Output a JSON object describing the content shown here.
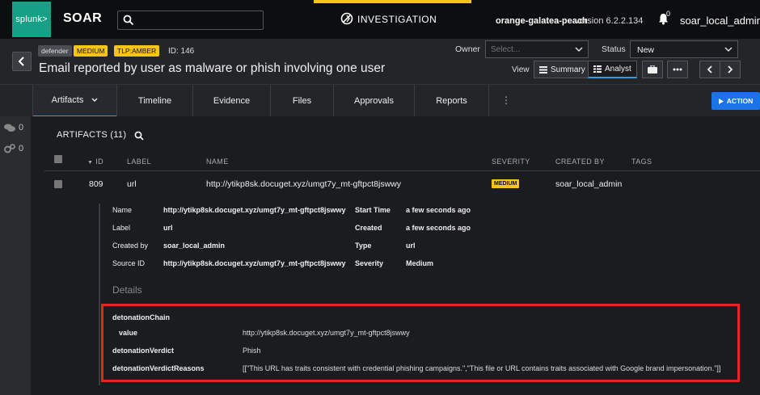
{
  "app": {
    "logo_text": "splunk>",
    "name": "SOAR"
  },
  "topbar": {
    "mode": "INVESTIGATION",
    "host": "orange-galatea-peach",
    "version": "version 6.2.2.134",
    "notification_count": "0",
    "user": "soar_local_admin"
  },
  "container": {
    "tags": [
      "defender",
      "MEDIUM",
      "TLP:AMBER"
    ],
    "id_label": "ID: 146",
    "title": "Email reported by user as malware or phish involving one user",
    "owner_label": "Owner",
    "owner_placeholder": "Select...",
    "status_label": "Status",
    "status_value": "New",
    "view_label": "View",
    "view_summary": "Summary",
    "view_analyst": "Analyst"
  },
  "tabs": [
    "Artifacts",
    "Timeline",
    "Evidence",
    "Files",
    "Approvals",
    "Reports"
  ],
  "action_label": "ACTION",
  "rail": {
    "comments": "0",
    "workflow": "0"
  },
  "artifacts": {
    "title": "ARTIFACTS (11)",
    "headers": {
      "id": "ID",
      "label": "LABEL",
      "name": "NAME",
      "severity": "SEVERITY",
      "created_by": "CREATED BY",
      "tags": "TAGS"
    },
    "row": {
      "id": "809",
      "label": "url",
      "name": "http://ytikp8sk.docuget.xyz/umgt7y_mt-gftpct8jswwy",
      "severity": "MEDIUM",
      "created_by": "soar_local_admin"
    },
    "detail": {
      "name_k": "Name",
      "name_v": "http://ytikp8sk.docuget.xyz/umgt7y_mt-gftpct8jswwy",
      "label_k": "Label",
      "label_v": "url",
      "createdby_k": "Created by",
      "createdby_v": "soar_local_admin",
      "sourceid_k": "Source ID",
      "sourceid_v": "http://ytikp8sk.docuget.xyz/umgt7y_mt-gftpct8jswwy",
      "start_k": "Start Time",
      "start_v": "a few seconds ago",
      "created_k": "Created",
      "created_v": "a few seconds ago",
      "type_k": "Type",
      "type_v": "url",
      "severity_k": "Severity",
      "severity_v": "Medium"
    },
    "details_title": "Details",
    "fields": {
      "chain_k": "detonationChain",
      "value_k": "value",
      "value_v": "http://ytikp8sk.docuget.xyz/umgt7y_mt-gftpct8jswwy",
      "verdict_k": "detonationVerdict",
      "verdict_v": "Phish",
      "reasons_k": "detonationVerdictReasons",
      "reasons_v": "[[\"This URL has traits consistent with credential phishing campaigns.\",\"This file or URL contains traits associated with Google brand impersonation.\"]]"
    }
  },
  "colors": {
    "brand": "#16a085",
    "accent": "#f5c518",
    "primary": "#1b73e8",
    "highlight": "#e0281c"
  }
}
